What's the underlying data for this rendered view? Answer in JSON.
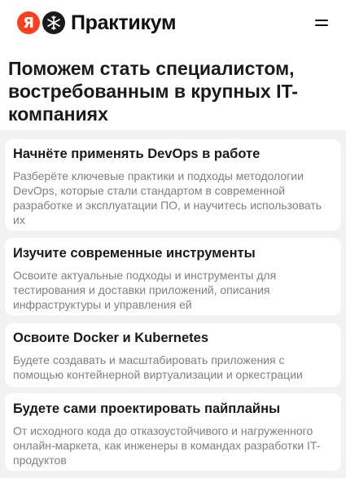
{
  "header": {
    "logo_letter": "Я",
    "brand_name": "Практикум",
    "menu_icon": "hamburger-menu-icon",
    "logo_icon": "praktikum-snowflake-icon",
    "accent_color": "#fc3f1d"
  },
  "hero": {
    "title": "Поможем стать специалистом, востребованным в крупных IT-компаниях"
  },
  "features": [
    {
      "title": "Начнёте применять DevOps в работе",
      "description": "Разберёте ключевые практики и подходы методологии DevOps, которые стали стандартом в современной разработке и эксплуатации ПО, и научитесь использовать их"
    },
    {
      "title": "Изучите современные инструменты",
      "description": "Освоите актуальные подходы и инструменты для тестирования и доставки приложений, описания инфраструктуры и управления ей"
    },
    {
      "title": "Освоите Docker и Kubernetes",
      "description": "Будете создавать и масштабировать приложения с помощью контейнерной виртуализации и оркестрации"
    },
    {
      "title": "Будете сами проектировать пайплайны",
      "description": "От исходного кода до отказоустойчивого и нагруженного онлайн-маркета, как инженеры в командах разработки IT-продуктов"
    }
  ]
}
